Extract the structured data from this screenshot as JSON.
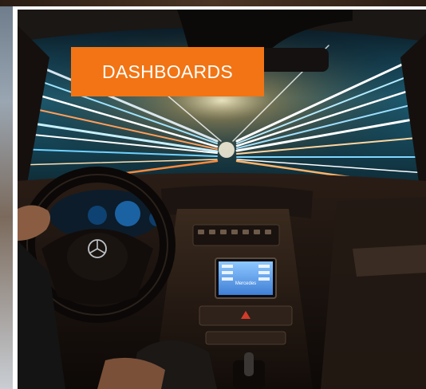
{
  "tile": {
    "label": "DASHBOARDS",
    "label_color": "#f27414",
    "image": "car-interior-night-light-trails"
  },
  "dashboard_screen": {
    "brand_text": "Mercedes"
  }
}
